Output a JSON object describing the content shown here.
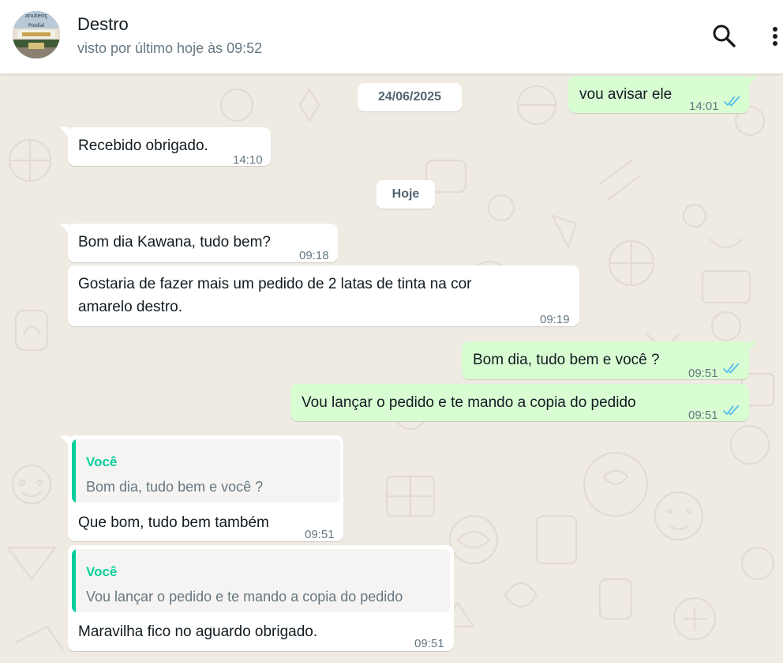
{
  "header": {
    "contact_name": "Destro",
    "status": "visto por último hoje às 09:52",
    "avatar_text_line1": "anutenç",
    "avatar_text_line2": "Predial"
  },
  "dates": {
    "first": "24/06/2025",
    "today": "Hoje"
  },
  "messages": [
    {
      "direction": "out",
      "text": "vou avisar ele",
      "time": "14:01",
      "read": true
    },
    {
      "direction": "in",
      "text": "Recebido obrigado.",
      "time": "14:10"
    },
    {
      "direction": "in",
      "text": "Bom dia Kawana, tudo bem?",
      "time": "09:18"
    },
    {
      "direction": "in",
      "text_line1": "Gostaria de fazer mais um pedido de 2 latas de tinta na cor",
      "text_line2": "amarelo destro.",
      "time": "09:19"
    },
    {
      "direction": "out",
      "text": "Bom dia, tudo bem e você ?",
      "time": "09:51",
      "read": true
    },
    {
      "direction": "out",
      "text": "Vou lançar o pedido e te mando a copia do pedido",
      "time": "09:51",
      "read": true
    },
    {
      "direction": "in",
      "quote_author": "Você",
      "quote_text": "Bom dia, tudo bem e você ?",
      "text": "Que bom, tudo bem também",
      "time": "09:51"
    },
    {
      "direction": "in",
      "quote_author": "Você",
      "quote_text": "Vou lançar o pedido e te mando a copia do pedido",
      "text": "Maravilha fico no aguardo obrigado.",
      "time": "09:51"
    }
  ],
  "icons": {
    "search": "search-icon",
    "menu": "more-vertical-icon",
    "read_receipt": "double-check-icon"
  },
  "colors": {
    "incoming_bubble": "#ffffff",
    "outgoing_bubble": "#d9fdd3",
    "read_tick": "#53bdeb",
    "quote_accent": "#06cf9c",
    "chat_background": "#efeae2"
  }
}
